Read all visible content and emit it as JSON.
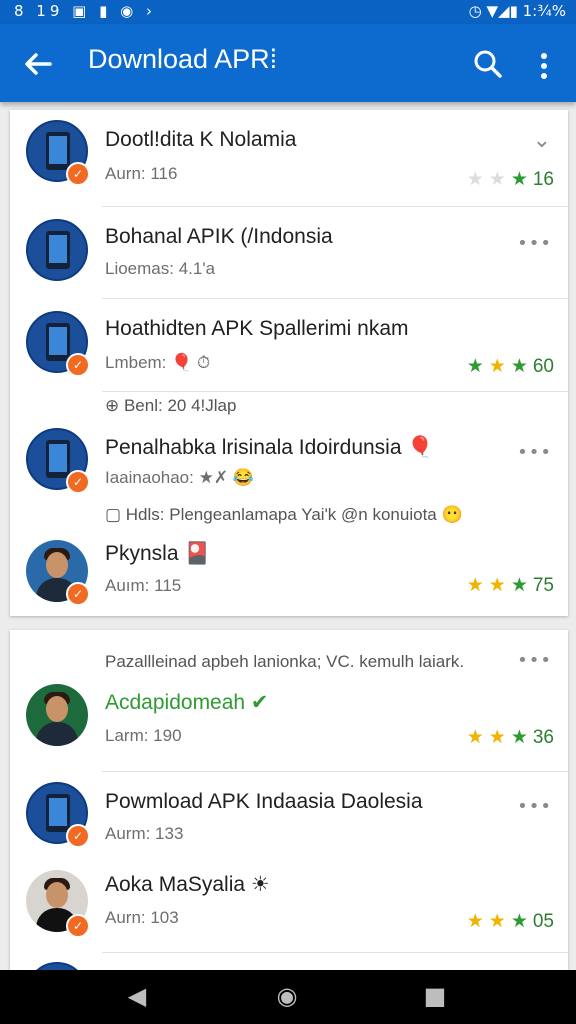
{
  "status_bar": {
    "left": "8 19 ▣ ▮ ◉ ›",
    "right": "◷ ▼◢▮ 1:¾%"
  },
  "app_bar": {
    "title": "Download APR⁞",
    "back_icon": "back-arrow-icon",
    "search_icon": "search-icon",
    "more_icon": "more-vert-icon",
    "color": "#0d6bd0"
  },
  "card1": [
    {
      "name": "Dootl!dita K Nolamia",
      "sub": "Aurn: 116",
      "rating_count": "16",
      "stars": [
        "grey",
        "grey",
        "green"
      ],
      "action": "⌄"
    },
    {
      "name": "Bohanal APIK (/Indonsia",
      "sub": "Lioemas: 4.1'a",
      "action": "•••"
    },
    {
      "name": "Hoathidten APK Spallerimi nkam",
      "sub": "Lmbem: 🎈 ⏱",
      "rating_count": "60",
      "stars": [
        "green",
        "yellow",
        "green"
      ]
    },
    {
      "note": "⊕ Benl: 20 4!Jlap"
    },
    {
      "name": "Penalhabka lrisinala Idoirdunsia 🎈",
      "sub": "Iaainaohao: ★✗ 😂",
      "action": "•••"
    },
    {
      "note": "▢ Hdls: Plengeanlamapa Yai'k @n konuiota 😶"
    },
    {
      "name": "Pkynsla 🎴",
      "sub": "Auım: 115",
      "rating_count": "75",
      "stars": [
        "yellow",
        "yellow",
        "green"
      ]
    }
  ],
  "card2": [
    {
      "header": "Pazallleinad apbeh lanionka; VC. kemulh laiark.",
      "action": "•••"
    },
    {
      "name": "Acdapidomeah ✔",
      "sub": "Larm: 190",
      "rating_count": "36",
      "stars": [
        "yellow",
        "yellow",
        "green"
      ]
    },
    {
      "name": "Powmload APK Indaasia Daolesia",
      "sub": "Aurm: 133",
      "action": "•••"
    },
    {
      "name": "Aoka MaSyalia ☀",
      "sub": "Aurn: 103",
      "rating_count": "05",
      "stars": [
        "yellow",
        "yellow",
        "green"
      ]
    }
  ],
  "colors": {
    "green_star": "#2e9b32",
    "yellow_star": "#f0b400",
    "grey_star": "#dddddd",
    "badge": "#f26a21"
  },
  "nav_bar": {
    "back": "◀",
    "home": "◉",
    "recents": "■"
  }
}
